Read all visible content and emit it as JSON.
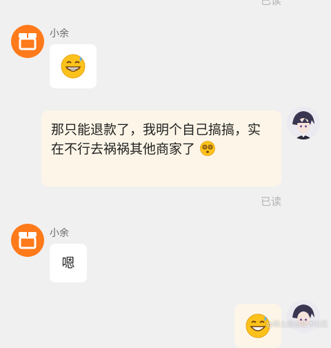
{
  "chat": {
    "read_top": "已读",
    "read_mid": "已读",
    "messages": [
      {
        "sender": "小余",
        "content_icon": "grinning-sweat-emoji"
      },
      {
        "sender": "me",
        "text": "那只能退款了，我明个自己搞搞，实在不行去祸祸其他商家了",
        "trailing_icon": "dizzy-eyes-emoji"
      },
      {
        "sender": "小余",
        "text": "嗯"
      },
      {
        "sender": "me",
        "content_icon": "grinning-sweat-emoji"
      }
    ]
  },
  "names": {
    "shop": "小余"
  },
  "watermark": "@稀土掘金技术社区",
  "colors": {
    "shop_avatar": "#ff7a1a",
    "outgoing_bubble": "#fdf6e8",
    "incoming_bubble": "#ffffff",
    "background": "#f0f0f0"
  }
}
